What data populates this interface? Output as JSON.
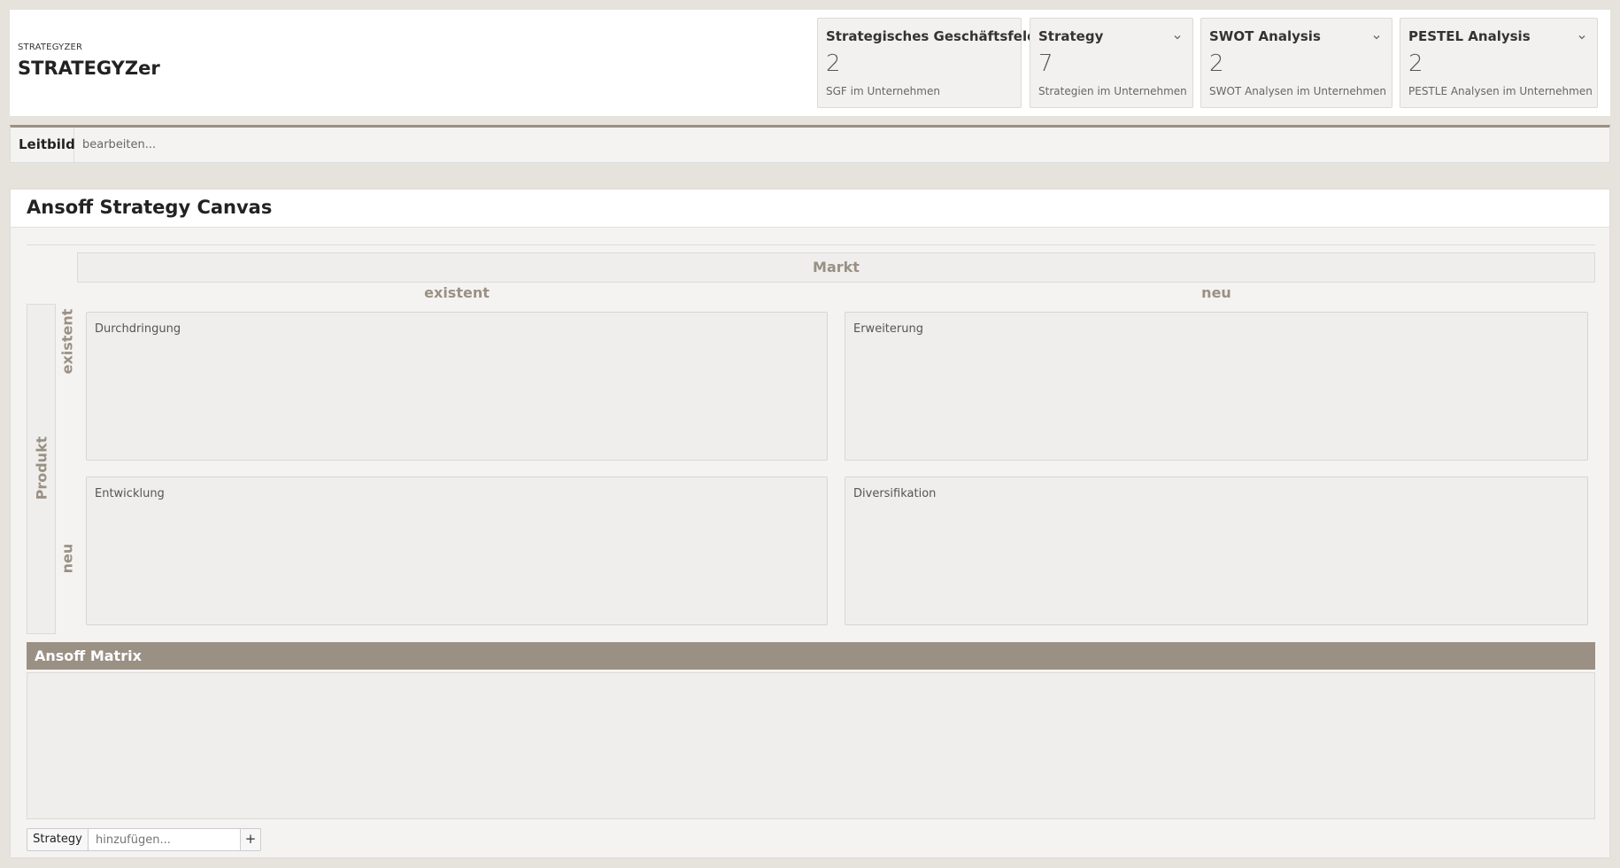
{
  "brand": {
    "small": "STRATEGYZER",
    "big": "STRATEGYZer"
  },
  "kpis": [
    {
      "title": "Strategisches Geschäftsfeld",
      "count": "2",
      "subtitle": "SGF im Unternehmen",
      "dropdown": false
    },
    {
      "title": "Strategy",
      "count": "7",
      "subtitle": "Strategien im Unternehmen",
      "dropdown": true
    },
    {
      "title": "SWOT Analysis",
      "count": "2",
      "subtitle": "SWOT Analysen im Unternehmen",
      "dropdown": true
    },
    {
      "title": "PESTEL Analysis",
      "count": "2",
      "subtitle": "PESTLE Analysen im Unternehmen",
      "dropdown": true
    }
  ],
  "leitbild": {
    "label": "Leitbild",
    "edit_text": "bearbeiten..."
  },
  "canvas": {
    "title": "Ansoff Strategy Canvas",
    "market_label": "Markt",
    "product_label": "Produkt",
    "columns": [
      "existent",
      "neu"
    ],
    "rows": [
      "existent",
      "neu"
    ],
    "cells": [
      "Durchdringung",
      "Erweiterung",
      "Entwicklung",
      "Diversifikation"
    ]
  },
  "matrix": {
    "title": "Ansoff Matrix"
  },
  "add_strategy": {
    "label": "Strategy",
    "placeholder": "hinzufügen...",
    "button": "+"
  },
  "colors": {
    "accent": "#9a9084",
    "background": "#e6e2dc",
    "panel": "#f4f3f1"
  },
  "icons": {
    "dropdown": "chevron-down-icon",
    "add": "plus-icon"
  }
}
